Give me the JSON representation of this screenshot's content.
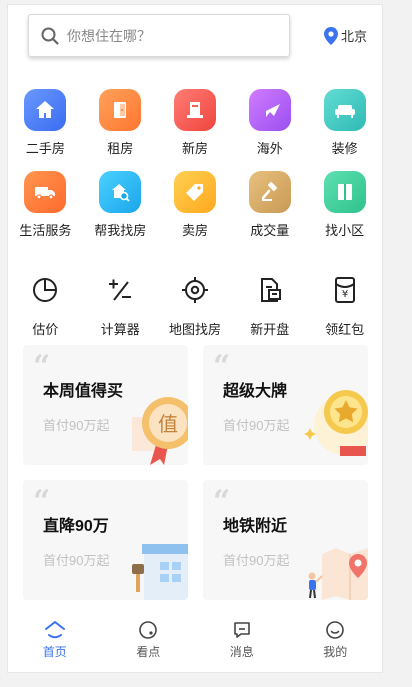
{
  "search": {
    "placeholder": "你想住在哪？"
  },
  "city": {
    "label": "北京"
  },
  "services_row1": [
    {
      "label": "二手房",
      "icon": "house-icon",
      "color": "#4a7cf5"
    },
    {
      "label": "租房",
      "icon": "door-icon",
      "color": "#ff8a3d"
    },
    {
      "label": "新房",
      "icon": "building-icon",
      "color": "#f5605b"
    },
    {
      "label": "海外",
      "icon": "airplane-icon",
      "color": "#b05cf0"
    },
    {
      "label": "装修",
      "icon": "sofa-icon",
      "color": "#3cc9c2"
    }
  ],
  "services_row2": [
    {
      "label": "生活服务",
      "icon": "truck-icon",
      "color": "#ff7b3d"
    },
    {
      "label": "帮我找房",
      "icon": "house-search-icon",
      "color": "#29b7f2"
    },
    {
      "label": "卖房",
      "icon": "price-tag-icon",
      "color": "#ffb92e"
    },
    {
      "label": "成交量",
      "icon": "gavel-icon",
      "color": "#d9a760"
    },
    {
      "label": "找小区",
      "icon": "book-icon",
      "color": "#3fcf9a"
    }
  ],
  "tools": [
    {
      "label": "估价",
      "icon": "pie-chart-icon"
    },
    {
      "label": "计算器",
      "icon": "calculator-icon"
    },
    {
      "label": "地图找房",
      "icon": "crosshair-icon"
    },
    {
      "label": "新开盘",
      "icon": "document-icon"
    },
    {
      "label": "领红包",
      "icon": "red-envelope-icon"
    }
  ],
  "cards": [
    {
      "title": "本周值得买",
      "sub": "首付90万起",
      "badge": "值"
    },
    {
      "title": "超级大牌",
      "sub": "首付90万起"
    },
    {
      "title": "直降90万",
      "sub": "首付90万起"
    },
    {
      "title": "地铁附近",
      "sub": "首付90万起"
    }
  ],
  "tabbar": [
    {
      "label": "首页",
      "icon": "home-icon",
      "active": true
    },
    {
      "label": "看点",
      "icon": "compass-icon"
    },
    {
      "label": "消息",
      "icon": "message-icon"
    },
    {
      "label": "我的",
      "icon": "profile-icon"
    }
  ],
  "colors": {
    "accent": "#3b72f0"
  }
}
